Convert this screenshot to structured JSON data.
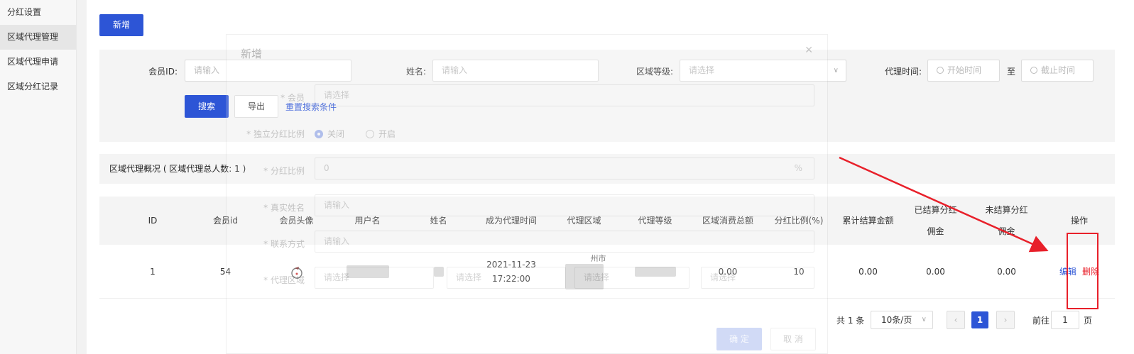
{
  "sidebar": {
    "items": [
      {
        "label": "分红设置"
      },
      {
        "label": "区域代理管理"
      },
      {
        "label": "区域代理申请"
      },
      {
        "label": "区域分红记录"
      }
    ]
  },
  "toolbar": {
    "add_label": "新增"
  },
  "filters": {
    "member_id": {
      "label": "会员ID:",
      "placeholder": "请输入"
    },
    "name": {
      "label": "姓名:",
      "placeholder": "请输入"
    },
    "region_level": {
      "label": "区域等级:",
      "placeholder": "请选择"
    },
    "agent_time": {
      "label": "代理时间:",
      "start_placeholder": "开始时间",
      "separator": "至",
      "end_placeholder": "截止时间"
    },
    "search_label": "搜索",
    "export_label": "导出",
    "reset_label": "重置搜索条件"
  },
  "summary": {
    "text": "区域代理概况 ( 区域代理总人数: 1 )"
  },
  "table": {
    "columns": [
      "ID",
      "会员id",
      "会员头像",
      "用户名",
      "姓名",
      "成为代理时间",
      "代理区域",
      "代理等级",
      "区域消费总额",
      "分红比例(%)",
      "累计结算金额",
      "已结算分红佣金",
      "未结算分红佣金",
      "操作"
    ],
    "rows": [
      {
        "id": "1",
        "member_id": "54",
        "join_time": "2021-11-23 17:22:00",
        "region_partial": "州市",
        "total_consumption": "0.00",
        "ratio": "10",
        "settled_total": "0.00",
        "settled_commission": "0.00",
        "unsettled_commission": "0.00",
        "edit_label": "编辑",
        "delete_label": "删除"
      }
    ]
  },
  "pagination": {
    "total_text": "共 1 条",
    "page_size": "10条/页",
    "current_page": "1",
    "goto_label": "前往",
    "goto_value": "1",
    "page_unit": "页"
  },
  "dialog": {
    "title": "新增",
    "member_label": "* 会员",
    "member_placeholder": "请选择",
    "independent_label": "* 独立分红比例",
    "opt_off": "关闭",
    "opt_on": "开启",
    "ratio_label": "* 分红比例",
    "ratio_value": "0",
    "ratio_unit": "%",
    "real_name_label": "* 真实姓名",
    "real_name_placeholder": "请输入",
    "contact_label": "* 联系方式",
    "contact_placeholder": "请输入",
    "region_label": "* 代理区域",
    "region_ph1": "请选择",
    "region_ph2": "请选择",
    "region_ph3": "请选择",
    "region_ph4": "请选择",
    "ok_label": "确 定",
    "cancel_label": "取 消"
  },
  "colors": {
    "primary": "#2d55d6",
    "danger": "#e8202a",
    "panel": "#f4f4f4"
  }
}
